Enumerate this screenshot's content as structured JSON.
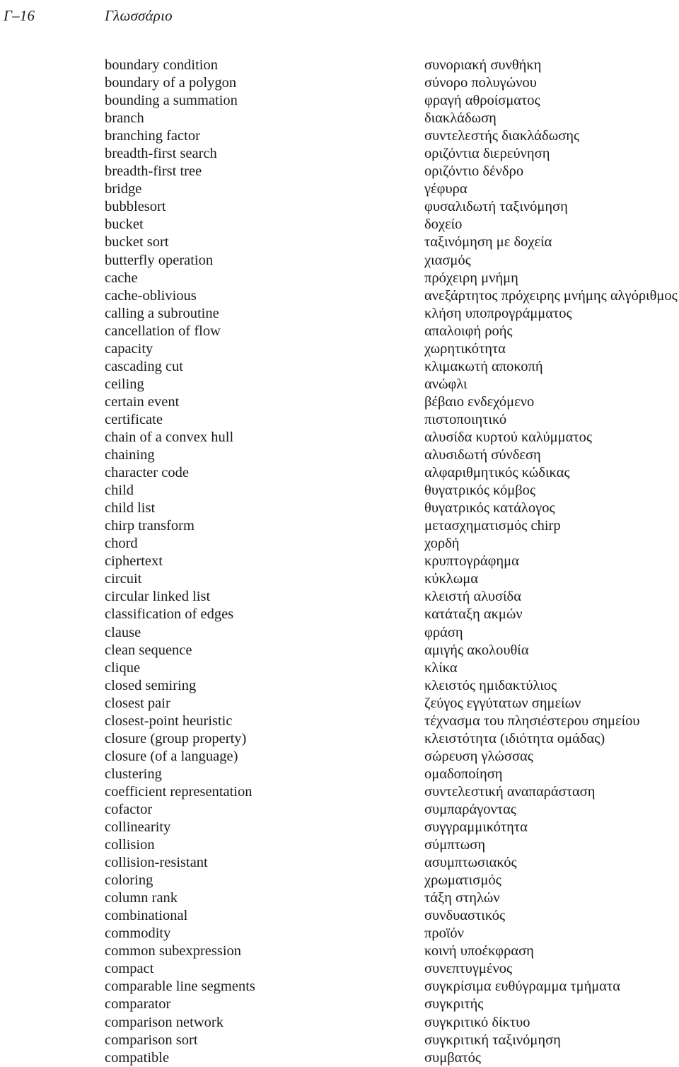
{
  "page": {
    "folio": "Γ–16",
    "running_title": "Γλωσσάριο",
    "background_color": "#ffffff",
    "text_color": "#1a1a1a"
  },
  "glossary": {
    "entries": [
      {
        "term": "boundary condition",
        "gloss": "συνοριακή συνθήκη"
      },
      {
        "term": "boundary of a polygon",
        "gloss": "σύνορο πολυγώνου"
      },
      {
        "term": "bounding a summation",
        "gloss": "φραγή αθροίσματος"
      },
      {
        "term": "branch",
        "gloss": "διακλάδωση"
      },
      {
        "term": "branching factor",
        "gloss": "συντελεστής διακλάδωσης"
      },
      {
        "term": "breadth-first search",
        "gloss": "οριζόντια διερεύνηση"
      },
      {
        "term": "breadth-first tree",
        "gloss": "οριζόντιο δένδρο"
      },
      {
        "term": "bridge",
        "gloss": "γέφυρα"
      },
      {
        "term": "bubblesort",
        "gloss": "φυσαλιδωτή ταξινόμηση"
      },
      {
        "term": "bucket",
        "gloss": "δοχείο"
      },
      {
        "term": "bucket sort",
        "gloss": "ταξινόμηση με δοχεία"
      },
      {
        "term": "butterfly operation",
        "gloss": "χιασμός"
      },
      {
        "term": "cache",
        "gloss": "πρόχειρη μνήμη"
      },
      {
        "term": "cache-oblivious",
        "gloss": "ανεξάρτητος πρόχειρης μνήμης αλγόριθμος"
      },
      {
        "term": "calling a subroutine",
        "gloss": "κλήση υποπρογράμματος"
      },
      {
        "term": "cancellation of flow",
        "gloss": "απαλοιφή ροής"
      },
      {
        "term": "capacity",
        "gloss": "χωρητικότητα"
      },
      {
        "term": "cascading cut",
        "gloss": "κλιμακωτή αποκοπή"
      },
      {
        "term": "ceiling",
        "gloss": "ανώφλι"
      },
      {
        "term": "certain event",
        "gloss": "βέβαιο ενδεχόμενο"
      },
      {
        "term": "certificate",
        "gloss": "πιστοποιητικό"
      },
      {
        "term": "chain of a convex hull",
        "gloss": "αλυσίδα κυρτού καλύμματος"
      },
      {
        "term": "chaining",
        "gloss": "αλυσιδωτή σύνδεση"
      },
      {
        "term": "character code",
        "gloss": "αλφαριθμητικός κώδικας"
      },
      {
        "term": "child",
        "gloss": "θυγατρικός κόμβος"
      },
      {
        "term": "child list",
        "gloss": "θυγατρικός κατάλογος"
      },
      {
        "term": "chirp transform",
        "gloss": "μετασχηματισμός chirp"
      },
      {
        "term": "chord",
        "gloss": "χορδή"
      },
      {
        "term": "ciphertext",
        "gloss": "κρυπτογράφημα"
      },
      {
        "term": "circuit",
        "gloss": "κύκλωμα"
      },
      {
        "term": "circular linked list",
        "gloss": "κλειστή αλυσίδα"
      },
      {
        "term": "classification of edges",
        "gloss": "κατάταξη ακμών"
      },
      {
        "term": "clause",
        "gloss": "φράση"
      },
      {
        "term": "clean sequence",
        "gloss": "αμιγής ακολουθία"
      },
      {
        "term": "clique",
        "gloss": "κλίκα"
      },
      {
        "term": "closed semiring",
        "gloss": "κλειστός ημιδακτύλιος"
      },
      {
        "term": "closest pair",
        "gloss": "ζεύγος εγγύτατων σημείων"
      },
      {
        "term": "closest-point heuristic",
        "gloss": "τέχνασμα του πλησιέστερου σημείου"
      },
      {
        "term": "closure (group property)",
        "gloss": "κλειστότητα (ιδιότητα ομάδας)"
      },
      {
        "term": "closure (of a language)",
        "gloss": "σώρευση γλώσσας"
      },
      {
        "term": "clustering",
        "gloss": "ομαδοποίηση"
      },
      {
        "term": "coefficient representation",
        "gloss": "συντελεστική αναπαράσταση"
      },
      {
        "term": "cofactor",
        "gloss": "συμπαράγοντας"
      },
      {
        "term": "collinearity",
        "gloss": "συγγραμμικότητα"
      },
      {
        "term": "collision",
        "gloss": "σύμπτωση"
      },
      {
        "term": "collision-resistant",
        "gloss": "ασυμπτωσιακός"
      },
      {
        "term": "coloring",
        "gloss": "χρωματισμός"
      },
      {
        "term": "column rank",
        "gloss": "τάξη στηλών"
      },
      {
        "term": "combinational",
        "gloss": "συνδυαστικός"
      },
      {
        "term": "commodity",
        "gloss": "προϊόν"
      },
      {
        "term": "common subexpression",
        "gloss": "κοινή υποέκφραση"
      },
      {
        "term": "compact",
        "gloss": "συνεπτυγμένος"
      },
      {
        "term": "comparable line segments",
        "gloss": "συγκρίσιμα ευθύγραμμα τμήματα"
      },
      {
        "term": "comparator",
        "gloss": "συγκριτής"
      },
      {
        "term": "comparison network",
        "gloss": "συγκριτικό δίκτυο"
      },
      {
        "term": "comparison sort",
        "gloss": "συγκριτική ταξινόμηση"
      },
      {
        "term": "compatible",
        "gloss": "συμβατός"
      }
    ]
  }
}
